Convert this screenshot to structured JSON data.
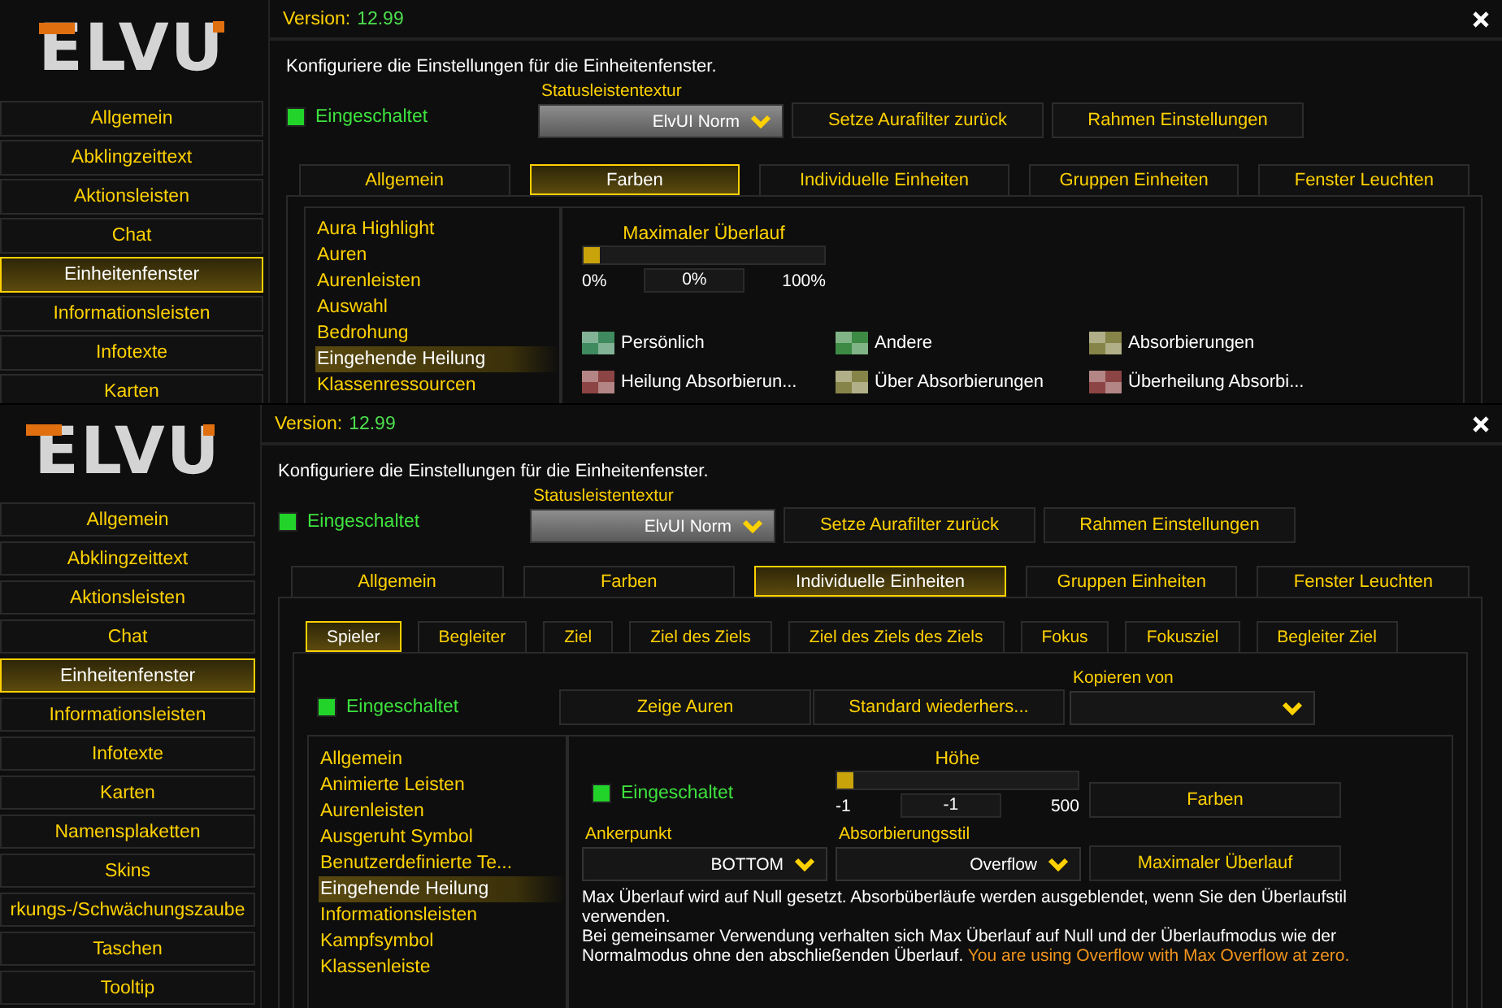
{
  "windows": [
    {
      "kind": "colors",
      "logo": "ELVU",
      "version_label": "Version:",
      "version": "12.99",
      "menu": [
        {
          "label": "Allgemein",
          "selected": false
        },
        {
          "label": "Abklingzeittext",
          "selected": false
        },
        {
          "label": "Aktionsleisten",
          "selected": false
        },
        {
          "label": "Chat",
          "selected": false
        },
        {
          "label": "Einheitenfenster",
          "selected": true
        },
        {
          "label": "Informationsleisten",
          "selected": false
        },
        {
          "label": "Infotexte",
          "selected": false
        },
        {
          "label": "Karten",
          "selected": false
        }
      ],
      "description": "Konfiguriere die Einstellungen für die Einheitenfenster.",
      "enabled": {
        "label": "Eingeschaltet",
        "checked": true
      },
      "texture": {
        "label": "Statusleistentextur",
        "value": "ElvUI Norm"
      },
      "buttons": [
        "Setze Aurafilter zurück",
        "Rahmen Einstellungen"
      ],
      "tabs": [
        {
          "label": "Allgemein",
          "selected": false
        },
        {
          "label": "Farben",
          "selected": true
        },
        {
          "label": "Individuelle Einheiten",
          "selected": false
        },
        {
          "label": "Gruppen Einheiten",
          "selected": false
        },
        {
          "label": "Fenster Leuchten",
          "selected": false
        }
      ],
      "list": [
        {
          "label": "Aura Highlight",
          "selected": false
        },
        {
          "label": "Auren",
          "selected": false
        },
        {
          "label": "Aurenleisten",
          "selected": false
        },
        {
          "label": "Auswahl",
          "selected": false
        },
        {
          "label": "Bedrohung",
          "selected": false
        },
        {
          "label": "Eingehende Heilung",
          "selected": true
        },
        {
          "label": "Klassenressourcen",
          "selected": false
        }
      ],
      "slider": {
        "label": "Maximaler Überlauf",
        "level": 0,
        "min": "0%",
        "value": "0%",
        "max": "100%"
      },
      "swatches": [
        {
          "label": "Persönlich",
          "color": "#3f8a5e"
        },
        {
          "label": "Andere",
          "color": "#3c8a44"
        },
        {
          "label": "Absorbierungen",
          "color": "#868448"
        },
        {
          "label": "Heilung Absorbierun...",
          "color": "#8c4444"
        },
        {
          "label": "Über Absorbierungen",
          "color": "#868448"
        },
        {
          "label": "Überheilung Absorbi...",
          "color": "#8c4444"
        }
      ]
    },
    {
      "kind": "units",
      "logo": "ELVU",
      "version_label": "Version:",
      "version": "12.99",
      "menu": [
        {
          "label": "Allgemein",
          "selected": false
        },
        {
          "label": "Abklingzeittext",
          "selected": false
        },
        {
          "label": "Aktionsleisten",
          "selected": false
        },
        {
          "label": "Chat",
          "selected": false
        },
        {
          "label": "Einheitenfenster",
          "selected": true
        },
        {
          "label": "Informationsleisten",
          "selected": false
        },
        {
          "label": "Infotexte",
          "selected": false
        },
        {
          "label": "Karten",
          "selected": false
        },
        {
          "label": "Namensplaketten",
          "selected": false
        },
        {
          "label": "Skins",
          "selected": false
        },
        {
          "label": "rkungs-/Schwächungszaube",
          "selected": false
        },
        {
          "label": "Taschen",
          "selected": false
        },
        {
          "label": "Tooltip",
          "selected": false
        }
      ],
      "description": "Konfiguriere die Einstellungen für die Einheitenfenster.",
      "enabled": {
        "label": "Eingeschaltet",
        "checked": true
      },
      "texture": {
        "label": "Statusleistentextur",
        "value": "ElvUI Norm"
      },
      "buttons": [
        "Setze Aurafilter zurück",
        "Rahmen Einstellungen"
      ],
      "tabs": [
        {
          "label": "Allgemein",
          "selected": false
        },
        {
          "label": "Farben",
          "selected": false
        },
        {
          "label": "Individuelle Einheiten",
          "selected": true
        },
        {
          "label": "Gruppen Einheiten",
          "selected": false
        },
        {
          "label": "Fenster Leuchten",
          "selected": false
        }
      ],
      "subtabs": [
        {
          "label": "Spieler",
          "selected": true
        },
        {
          "label": "Begleiter",
          "selected": false
        },
        {
          "label": "Ziel",
          "selected": false
        },
        {
          "label": "Ziel des Ziels",
          "selected": false
        },
        {
          "label": "Ziel des Ziels des Ziels",
          "selected": false
        },
        {
          "label": "Fokus",
          "selected": false
        },
        {
          "label": "Fokusziel",
          "selected": false
        },
        {
          "label": "Begleiter Ziel",
          "selected": false
        }
      ],
      "unit_enabled": {
        "label": "Eingeschaltet",
        "checked": true
      },
      "unit_buttons": [
        "Zeige Auren",
        "Standard wiederhers..."
      ],
      "copy_from": {
        "label": "Kopieren von"
      },
      "list": [
        {
          "label": "Allgemein",
          "selected": false
        },
        {
          "label": "Animierte Leisten",
          "selected": false
        },
        {
          "label": "Aurenleisten",
          "selected": false
        },
        {
          "label": "Ausgeruht Symbol",
          "selected": false
        },
        {
          "label": "Benutzerdefinierte Te...",
          "selected": false
        },
        {
          "label": "Eingehende Heilung",
          "selected": true
        },
        {
          "label": "Informationsleisten",
          "selected": false
        },
        {
          "label": "Kampfsymbol",
          "selected": false
        },
        {
          "label": "Klassenleiste",
          "selected": false
        }
      ],
      "detail": {
        "enabled": {
          "label": "Eingeschaltet",
          "checked": true
        },
        "slider": {
          "label": "Höhe",
          "level": 0,
          "min": "-1",
          "value": "-1",
          "max": "500"
        },
        "colors_button": "Farben",
        "anchor": {
          "label": "Ankerpunkt",
          "value": "BOTTOM"
        },
        "absorb_style": {
          "label": "Absorbierungsstil",
          "value": "Overflow"
        },
        "overflow_button": "Maximaler Überlauf",
        "note": {
          "text": "Max Überlauf wird auf Null gesetzt. Absorbüberläufe werden ausgeblendet, wenn Sie den Überlaufstil verwenden.\nBei gemeinsamer Verwendung verhalten sich Max Überlauf auf Null und der Überlaufmodus wie der Normalmodus ohne den abschließenden Überlauf.",
          "warning": "You are using Overflow with Max Overflow at zero."
        }
      }
    }
  ]
}
